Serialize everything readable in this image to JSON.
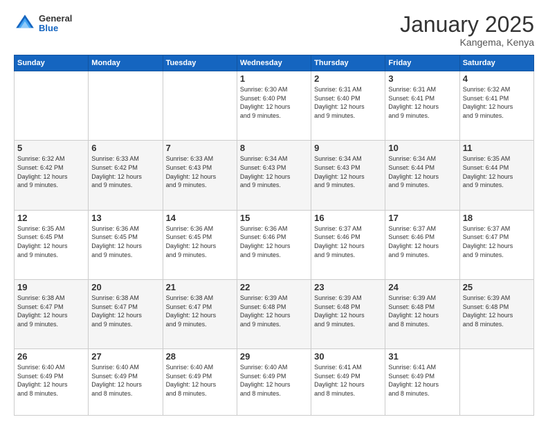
{
  "logo": {
    "general": "General",
    "blue": "Blue"
  },
  "header": {
    "month": "January 2025",
    "location": "Kangema, Kenya"
  },
  "weekdays": [
    "Sunday",
    "Monday",
    "Tuesday",
    "Wednesday",
    "Thursday",
    "Friday",
    "Saturday"
  ],
  "weeks": [
    [
      {
        "day": "",
        "info": ""
      },
      {
        "day": "",
        "info": ""
      },
      {
        "day": "",
        "info": ""
      },
      {
        "day": "1",
        "info": "Sunrise: 6:30 AM\nSunset: 6:40 PM\nDaylight: 12 hours\nand 9 minutes."
      },
      {
        "day": "2",
        "info": "Sunrise: 6:31 AM\nSunset: 6:40 PM\nDaylight: 12 hours\nand 9 minutes."
      },
      {
        "day": "3",
        "info": "Sunrise: 6:31 AM\nSunset: 6:41 PM\nDaylight: 12 hours\nand 9 minutes."
      },
      {
        "day": "4",
        "info": "Sunrise: 6:32 AM\nSunset: 6:41 PM\nDaylight: 12 hours\nand 9 minutes."
      }
    ],
    [
      {
        "day": "5",
        "info": "Sunrise: 6:32 AM\nSunset: 6:42 PM\nDaylight: 12 hours\nand 9 minutes."
      },
      {
        "day": "6",
        "info": "Sunrise: 6:33 AM\nSunset: 6:42 PM\nDaylight: 12 hours\nand 9 minutes."
      },
      {
        "day": "7",
        "info": "Sunrise: 6:33 AM\nSunset: 6:43 PM\nDaylight: 12 hours\nand 9 minutes."
      },
      {
        "day": "8",
        "info": "Sunrise: 6:34 AM\nSunset: 6:43 PM\nDaylight: 12 hours\nand 9 minutes."
      },
      {
        "day": "9",
        "info": "Sunrise: 6:34 AM\nSunset: 6:43 PM\nDaylight: 12 hours\nand 9 minutes."
      },
      {
        "day": "10",
        "info": "Sunrise: 6:34 AM\nSunset: 6:44 PM\nDaylight: 12 hours\nand 9 minutes."
      },
      {
        "day": "11",
        "info": "Sunrise: 6:35 AM\nSunset: 6:44 PM\nDaylight: 12 hours\nand 9 minutes."
      }
    ],
    [
      {
        "day": "12",
        "info": "Sunrise: 6:35 AM\nSunset: 6:45 PM\nDaylight: 12 hours\nand 9 minutes."
      },
      {
        "day": "13",
        "info": "Sunrise: 6:36 AM\nSunset: 6:45 PM\nDaylight: 12 hours\nand 9 minutes."
      },
      {
        "day": "14",
        "info": "Sunrise: 6:36 AM\nSunset: 6:45 PM\nDaylight: 12 hours\nand 9 minutes."
      },
      {
        "day": "15",
        "info": "Sunrise: 6:36 AM\nSunset: 6:46 PM\nDaylight: 12 hours\nand 9 minutes."
      },
      {
        "day": "16",
        "info": "Sunrise: 6:37 AM\nSunset: 6:46 PM\nDaylight: 12 hours\nand 9 minutes."
      },
      {
        "day": "17",
        "info": "Sunrise: 6:37 AM\nSunset: 6:46 PM\nDaylight: 12 hours\nand 9 minutes."
      },
      {
        "day": "18",
        "info": "Sunrise: 6:37 AM\nSunset: 6:47 PM\nDaylight: 12 hours\nand 9 minutes."
      }
    ],
    [
      {
        "day": "19",
        "info": "Sunrise: 6:38 AM\nSunset: 6:47 PM\nDaylight: 12 hours\nand 9 minutes."
      },
      {
        "day": "20",
        "info": "Sunrise: 6:38 AM\nSunset: 6:47 PM\nDaylight: 12 hours\nand 9 minutes."
      },
      {
        "day": "21",
        "info": "Sunrise: 6:38 AM\nSunset: 6:47 PM\nDaylight: 12 hours\nand 9 minutes."
      },
      {
        "day": "22",
        "info": "Sunrise: 6:39 AM\nSunset: 6:48 PM\nDaylight: 12 hours\nand 9 minutes."
      },
      {
        "day": "23",
        "info": "Sunrise: 6:39 AM\nSunset: 6:48 PM\nDaylight: 12 hours\nand 9 minutes."
      },
      {
        "day": "24",
        "info": "Sunrise: 6:39 AM\nSunset: 6:48 PM\nDaylight: 12 hours\nand 8 minutes."
      },
      {
        "day": "25",
        "info": "Sunrise: 6:39 AM\nSunset: 6:48 PM\nDaylight: 12 hours\nand 8 minutes."
      }
    ],
    [
      {
        "day": "26",
        "info": "Sunrise: 6:40 AM\nSunset: 6:49 PM\nDaylight: 12 hours\nand 8 minutes."
      },
      {
        "day": "27",
        "info": "Sunrise: 6:40 AM\nSunset: 6:49 PM\nDaylight: 12 hours\nand 8 minutes."
      },
      {
        "day": "28",
        "info": "Sunrise: 6:40 AM\nSunset: 6:49 PM\nDaylight: 12 hours\nand 8 minutes."
      },
      {
        "day": "29",
        "info": "Sunrise: 6:40 AM\nSunset: 6:49 PM\nDaylight: 12 hours\nand 8 minutes."
      },
      {
        "day": "30",
        "info": "Sunrise: 6:41 AM\nSunset: 6:49 PM\nDaylight: 12 hours\nand 8 minutes."
      },
      {
        "day": "31",
        "info": "Sunrise: 6:41 AM\nSunset: 6:49 PM\nDaylight: 12 hours\nand 8 minutes."
      },
      {
        "day": "",
        "info": ""
      }
    ]
  ]
}
